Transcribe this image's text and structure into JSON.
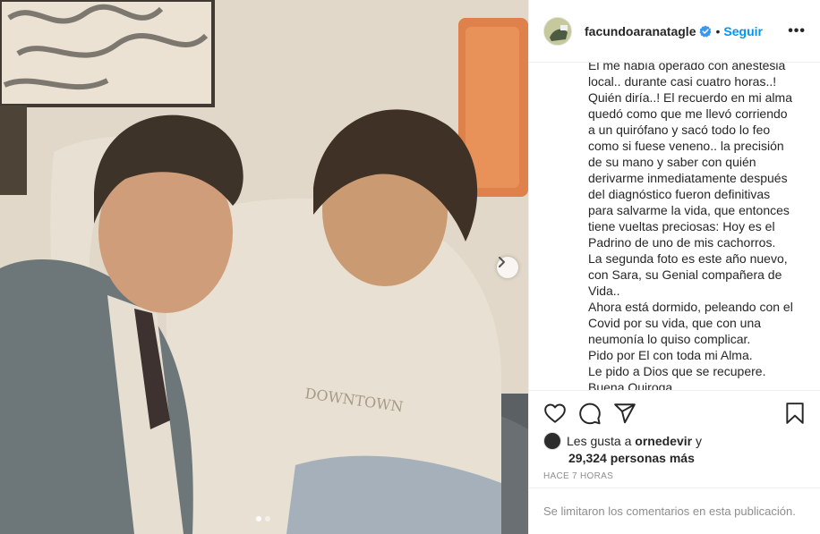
{
  "post": {
    "username": "facundoaranatagle",
    "separator": "•",
    "follow_label": "Seguir",
    "more_label": "•••",
    "caption": "El me había operado con anestesia local.. durante casi cuatro horas..!\nQuién diría..! El recuerdo en mi alma quedó como que me llevó corriendo a un quirófano y sacó todo lo feo como si fuese veneno.. la precisión de su mano y saber con quién derivarme inmediatamente después del diagnóstico fueron definitivas para salvarme la vida, que entonces tiene vueltas preciosas: Hoy es el Padrino de uno de mis cachorros.\nLa segunda foto es este año nuevo, con Sara, su Genial compañera de Vida..\nAhora está dormido, peleando con el Covid por su vida, que con una neumonía lo quiso complicar.\nPido por El con toda mi Alma.\nLe pido a Dios que se recupere.\nBuena Quiroga...",
    "likes_prefix": "Les gusta a",
    "likes_user": "ornedevir",
    "likes_conj": "y",
    "likes_count": "29,324 personas más",
    "timestamp": "HACE 7 HORAS",
    "comments_disabled": "Se limitaron los comentarios en esta publicación.",
    "photo_text": "DOWNTOWN",
    "carousel": {
      "current": 1,
      "total": 2
    }
  },
  "icons": {
    "like": "heart-icon",
    "comment": "comment-icon",
    "share": "share-icon",
    "save": "bookmark-icon",
    "next": "chevron-right-icon",
    "verified": "verified-badge-icon"
  },
  "colors": {
    "accent": "#0095f6",
    "text": "#262626",
    "muted": "#8e8e8e",
    "border": "#efefef"
  }
}
